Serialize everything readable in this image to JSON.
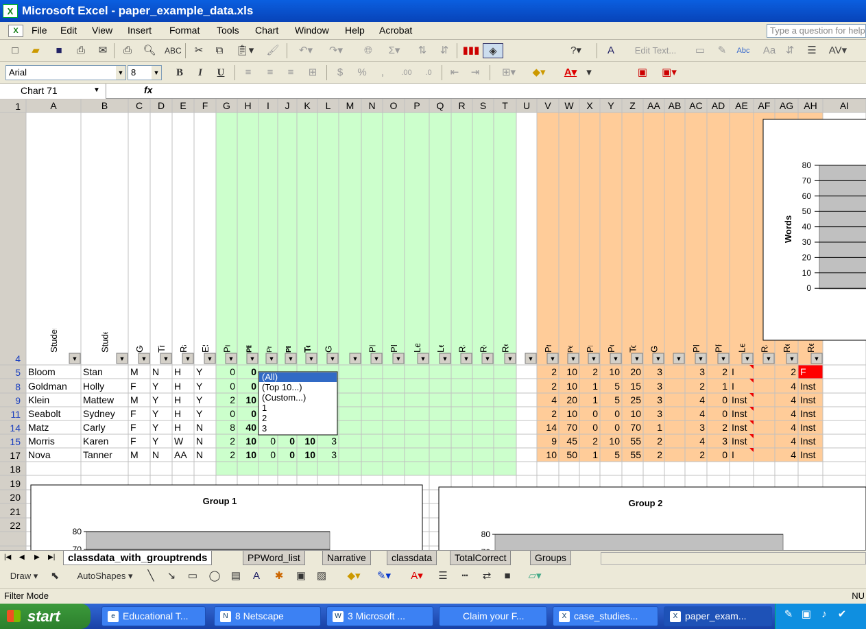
{
  "window": {
    "title": "Microsoft Excel - paper_example_data.xls",
    "app_icon": "excel-icon"
  },
  "menu": {
    "items": [
      "File",
      "Edit",
      "View",
      "Insert",
      "Format",
      "Tools",
      "Chart",
      "Window",
      "Help",
      "Acrobat"
    ],
    "help_placeholder": "Type a question for help"
  },
  "formatting": {
    "font": "Arial",
    "size": "8"
  },
  "standard_toolbar": {
    "edit_text": "Edit Text..."
  },
  "formula_bar": {
    "name_box": "Chart 71",
    "fx": "fx",
    "content": ""
  },
  "columns": [
    "A",
    "B",
    "C",
    "D",
    "E",
    "F",
    "G",
    "H",
    "I",
    "J",
    "K",
    "L",
    "M",
    "N",
    "O",
    "P",
    "Q",
    "R",
    "S",
    "T",
    "U",
    "V",
    "W",
    "X",
    "Y",
    "Z",
    "AA",
    "AB",
    "AC",
    "AD",
    "AE",
    "AF",
    "AG",
    "AH",
    "AI"
  ],
  "headers": {
    "A": "Student Last Name",
    "B": "Student First Name",
    "C": "Gender M/F",
    "D": "Title I Yes/No",
    "E": "Race",
    "F": "ESOL Yes/No",
    "G": "Pre Primer Word List Total Correct Automatic (number)",
    "H": "PERCENT Pre Primer Word List Total Correct Automatic",
    "I": "Pre Primer Word List Total Correct Identified",
    "J": "PERCENT Pre Primer Word List Total Correct Identified",
    "K": "Total Number Correct",
    "L": "Group",
    "M": "",
    "N": "PP Narrative Total Accuracy",
    "O": "PP Narrative--Total Accepability",
    "P": "Level (Inst Independent--frustration)",
    "Q": "Level",
    "R": "Rate",
    "S": "Recall Number correct Explicit",
    "T": "Recall Level",
    "U": "",
    "V": "Pre Primer Word List Total Correct Automatic",
    "W": "Percent Pre Primer Word List Total Correct Automatic",
    "X": "Pre Primer Word List Total Correct Identified",
    "Y": "Percentage Pre Primer Word List Total Correct Identified",
    "Z": "Total Number Correct",
    "AA": "Group",
    "AB": "",
    "AC": "PP Narrative Total Accuracy",
    "AD": "PP Narrative--Total Accepability",
    "AE": "Level (Inst Independent--frustration)",
    "AF": "Rate",
    "AG": "Recall",
    "AH": "Recall"
  },
  "rows": [
    {
      "num": "4",
      "cells": [
        "Bloom",
        "Stan",
        "M",
        "N",
        "H",
        "Y",
        "0",
        "0",
        "",
        "",
        "",
        "",
        "",
        "",
        "",
        "",
        "",
        "",
        "",
        "",
        "",
        "2",
        "10",
        "2",
        "10",
        "20",
        "3",
        "",
        "3",
        "2",
        "I",
        "",
        "2",
        "F"
      ]
    },
    {
      "num": "5",
      "cells": [
        "Goldman",
        "Holly",
        "F",
        "Y",
        "H",
        "Y",
        "0",
        "0",
        "",
        "",
        "",
        "",
        "",
        "",
        "",
        "",
        "",
        "",
        "",
        "",
        "",
        "2",
        "10",
        "1",
        "5",
        "15",
        "3",
        "",
        "2",
        "1",
        "I",
        "",
        "4",
        "Inst"
      ]
    },
    {
      "num": "8",
      "cells": [
        "Klein",
        "Mattew",
        "M",
        "Y",
        "H",
        "Y",
        "2",
        "10",
        "",
        "",
        "",
        "",
        "",
        "",
        "",
        "",
        "",
        "",
        "",
        "",
        "",
        "4",
        "20",
        "1",
        "5",
        "25",
        "3",
        "",
        "4",
        "0",
        "Inst",
        "",
        "4",
        "Inst"
      ]
    },
    {
      "num": "9",
      "cells": [
        "Seabolt",
        "Sydney",
        "F",
        "Y",
        "H",
        "Y",
        "0",
        "0",
        "",
        "",
        "",
        "",
        "",
        "",
        "",
        "",
        "",
        "",
        "",
        "",
        "",
        "2",
        "10",
        "0",
        "0",
        "10",
        "3",
        "",
        "4",
        "0",
        "Inst",
        "",
        "4",
        "Inst"
      ]
    },
    {
      "num": "11",
      "cells": [
        "Matz",
        "Carly",
        "F",
        "Y",
        "H",
        "N",
        "8",
        "40",
        "",
        "",
        "",
        "",
        "",
        "",
        "",
        "",
        "",
        "",
        "",
        "",
        "",
        "14",
        "70",
        "0",
        "0",
        "70",
        "1",
        "",
        "3",
        "2",
        "Inst",
        "",
        "4",
        "Inst"
      ]
    },
    {
      "num": "14",
      "cells": [
        "Morris",
        "Karen",
        "F",
        "Y",
        "W",
        "N",
        "2",
        "10",
        "0",
        "0",
        "10",
        "3",
        "",
        "",
        "",
        "",
        "",
        "",
        "",
        "",
        "",
        "9",
        "45",
        "2",
        "10",
        "55",
        "2",
        "",
        "4",
        "3",
        "Inst",
        "",
        "4",
        "Inst"
      ]
    },
    {
      "num": "15",
      "cells": [
        "Nova",
        "Tanner",
        "M",
        "N",
        "AA",
        "N",
        "2",
        "10",
        "0",
        "0",
        "10",
        "3",
        "",
        "",
        "",
        "",
        "",
        "",
        "",
        "",
        "",
        "10",
        "50",
        "1",
        "5",
        "55",
        "2",
        "",
        "2",
        "0",
        "I",
        "",
        "4",
        "Inst"
      ]
    }
  ],
  "empty_rows": [
    "17",
    "18",
    "19",
    "20",
    "21",
    "22"
  ],
  "filter_dropdown": {
    "options": [
      "(All)",
      "(Top 10...)",
      "(Custom...)",
      "1",
      "2",
      "3"
    ],
    "selected": "(All)"
  },
  "charts": [
    {
      "title": "Group 1",
      "ylabel": "",
      "ticks": [
        "80",
        "70"
      ]
    },
    {
      "title": "Group 2",
      "ylabel": "",
      "ticks": [
        "80",
        "70"
      ]
    },
    {
      "title": "",
      "ylabel": "Words",
      "ticks": [
        "80",
        "70",
        "60",
        "50",
        "40",
        "30",
        "20",
        "10",
        "0"
      ]
    }
  ],
  "sheet_tabs": [
    "classdata_with_grouptrends",
    "PPWord_list",
    "Narrative",
    "classdata",
    "TotalCorrect",
    "Groups"
  ],
  "drawing": {
    "draw": "Draw",
    "autoshapes": "AutoShapes"
  },
  "status": {
    "mode": "Filter Mode",
    "num": "NU"
  },
  "taskbar": {
    "start": "start",
    "tasks": [
      "Educational T...",
      "8 Netscape",
      "3 Microsoft ...",
      "Claim your F...",
      "case_studies...",
      "paper_exam..."
    ]
  },
  "colors": {
    "green": "#ccffcc",
    "orange": "#ffcc99",
    "red_cell": "#ff0000",
    "header_bg": "#d4d0c8",
    "titlebar": "#0a5fe0"
  }
}
